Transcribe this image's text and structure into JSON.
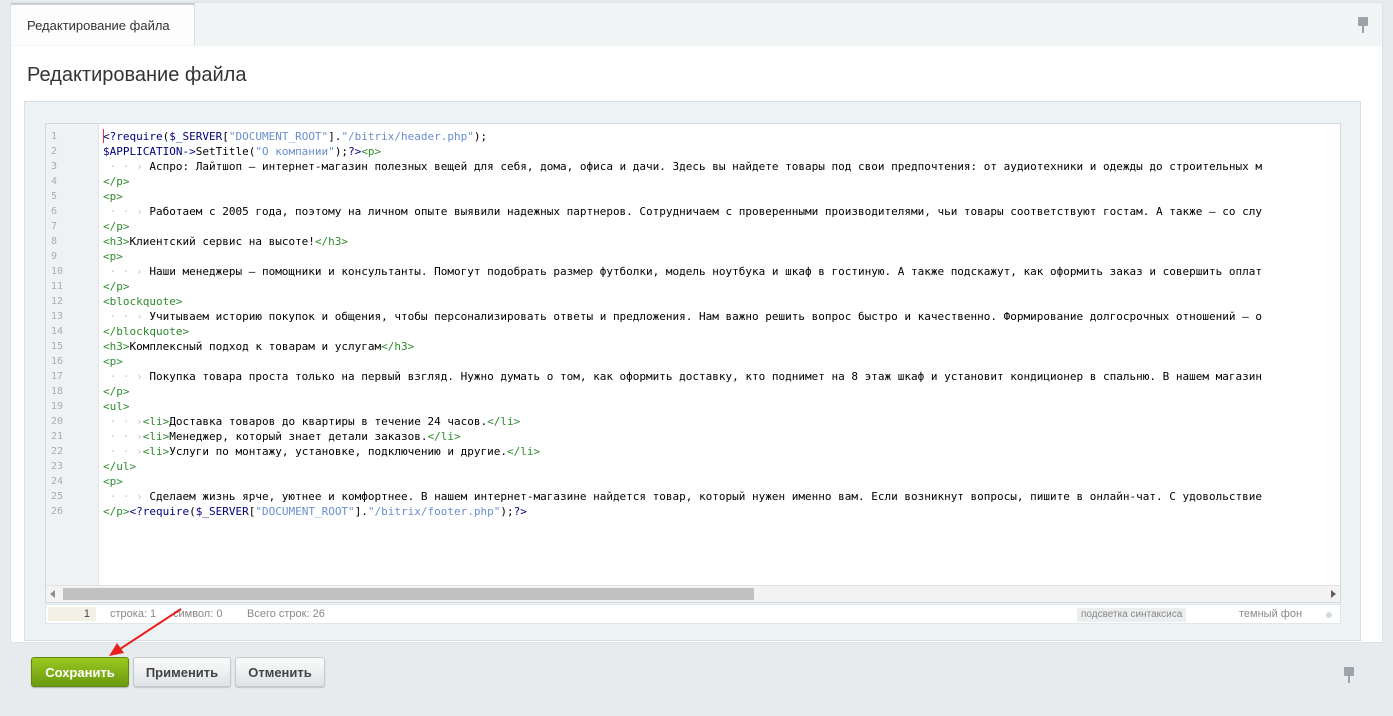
{
  "tab": {
    "label": "Редактирование файла"
  },
  "page": {
    "title": "Редактирование файла"
  },
  "editor": {
    "line_numbers": [
      "1",
      "2",
      "3",
      "4",
      "5",
      "6",
      "7",
      "8",
      "9",
      "10",
      "11",
      "12",
      "13",
      "14",
      "15",
      "16",
      "17",
      "18",
      "19",
      "20",
      "21",
      "22",
      "23",
      "24",
      "25",
      "26"
    ],
    "lines": [
      [
        {
          "t": "<?require",
          "c": "#000080"
        },
        {
          "t": "(",
          "c": "#000"
        },
        {
          "t": "$_SERVER",
          "c": "#000080"
        },
        {
          "t": "[",
          "c": "#000"
        },
        {
          "t": "\"DOCUMENT_ROOT\"",
          "c": "#6a8ed0"
        },
        {
          "t": "].",
          "c": "#000"
        },
        {
          "t": "\"/bitrix/header.php\"",
          "c": "#6a8ed0"
        },
        {
          "t": ");",
          "c": "#000"
        }
      ],
      [
        {
          "t": "$APPLICATION->",
          "c": "#000080"
        },
        {
          "t": "SetTitle(",
          "c": "#000"
        },
        {
          "t": "\"О компании\"",
          "c": "#6a8ed0"
        },
        {
          "t": ");",
          "c": "#000"
        },
        {
          "t": "?>",
          "c": "#000080"
        },
        {
          "t": "<p>",
          "c": "#2e8b2e"
        }
      ],
      [
        {
          "t": " · · › ",
          "c": "#c8c8c8"
        },
        {
          "t": "Аспро: Лайтшоп — интернет-магазин полезных вещей для себя, дома, офиса и дачи. Здесь вы найдете товары под свои предпочтения: от аудиотехники и одежды до строительных м",
          "c": "#000"
        }
      ],
      [
        {
          "t": "</p>",
          "c": "#2e8b2e"
        }
      ],
      [
        {
          "t": "<p>",
          "c": "#2e8b2e"
        }
      ],
      [
        {
          "t": " · · › ",
          "c": "#c8c8c8"
        },
        {
          "t": "Работаем с 2005 года, поэтому на личном опыте выявили надежных партнеров. Сотрудничаем с проверенными производителями, чьи товары соответствуют гостам. А также — со слу",
          "c": "#000"
        }
      ],
      [
        {
          "t": "</p>",
          "c": "#2e8b2e"
        }
      ],
      [
        {
          "t": "<h3>",
          "c": "#2e8b2e"
        },
        {
          "t": "Клиентский сервис на высоте!",
          "c": "#000"
        },
        {
          "t": "</h3>",
          "c": "#2e8b2e"
        }
      ],
      [
        {
          "t": "<p>",
          "c": "#2e8b2e"
        }
      ],
      [
        {
          "t": " · · › ",
          "c": "#c8c8c8"
        },
        {
          "t": "Наши менеджеры — помощники и консультанты. Помогут подобрать размер футболки, модель ноутбука и шкаф в гостиную. А также подскажут, как оформить заказ и совершить оплат",
          "c": "#000"
        }
      ],
      [
        {
          "t": "</p>",
          "c": "#2e8b2e"
        }
      ],
      [
        {
          "t": "<blockquote>",
          "c": "#2e8b2e"
        }
      ],
      [
        {
          "t": " · · › ",
          "c": "#c8c8c8"
        },
        {
          "t": "Учитываем историю покупок и общения, чтобы персонализировать ответы и предложения. Нам важно решить вопрос быстро и качественно. Формирование долгосрочных отношений — о",
          "c": "#000"
        }
      ],
      [
        {
          "t": "</blockquote>",
          "c": "#2e8b2e"
        }
      ],
      [
        {
          "t": "<h3>",
          "c": "#2e8b2e"
        },
        {
          "t": "Комплексный подход к товарам и услугам",
          "c": "#000"
        },
        {
          "t": "</h3>",
          "c": "#2e8b2e"
        }
      ],
      [
        {
          "t": "<p>",
          "c": "#2e8b2e"
        }
      ],
      [
        {
          "t": " · · › ",
          "c": "#c8c8c8"
        },
        {
          "t": "Покупка товара проста только на первый взгляд. Нужно думать о том, как оформить доставку, кто поднимет на 8 этаж шкаф и установит кондиционер в спальню. В нашем магазин",
          "c": "#000"
        }
      ],
      [
        {
          "t": "</p>",
          "c": "#2e8b2e"
        }
      ],
      [
        {
          "t": "<ul>",
          "c": "#2e8b2e"
        }
      ],
      [
        {
          "t": " · · ›",
          "c": "#c8c8c8"
        },
        {
          "t": "<li>",
          "c": "#2e8b2e"
        },
        {
          "t": "Доставка товаров до квартиры в течение 24 часов.",
          "c": "#000"
        },
        {
          "t": "</li>",
          "c": "#2e8b2e"
        }
      ],
      [
        {
          "t": " · · ›",
          "c": "#c8c8c8"
        },
        {
          "t": "<li>",
          "c": "#2e8b2e"
        },
        {
          "t": "Менеджер, который знает детали заказов.",
          "c": "#000"
        },
        {
          "t": "</li>",
          "c": "#2e8b2e"
        }
      ],
      [
        {
          "t": " · · ›",
          "c": "#c8c8c8"
        },
        {
          "t": "<li>",
          "c": "#2e8b2e"
        },
        {
          "t": "Услуги по монтажу, установке, подключению и другие.",
          "c": "#000"
        },
        {
          "t": "</li>",
          "c": "#2e8b2e"
        }
      ],
      [
        {
          "t": "</ul>",
          "c": "#2e8b2e"
        }
      ],
      [
        {
          "t": "<p>",
          "c": "#2e8b2e"
        }
      ],
      [
        {
          "t": " · · › ",
          "c": "#c8c8c8"
        },
        {
          "t": "Сделаем жизнь ярче, уютнее и комфортнее. В нашем интернет-магазине найдется товар, который нужен именно вам. Если возникнут вопросы, пишите в онлайн-чат. С удовольствие",
          "c": "#000"
        }
      ],
      [
        {
          "t": "</p>",
          "c": "#2e8b2e"
        },
        {
          "t": "<?require",
          "c": "#000080"
        },
        {
          "t": "(",
          "c": "#000"
        },
        {
          "t": "$_SERVER",
          "c": "#000080"
        },
        {
          "t": "[",
          "c": "#000"
        },
        {
          "t": "\"DOCUMENT_ROOT\"",
          "c": "#6a8ed0"
        },
        {
          "t": "].",
          "c": "#000"
        },
        {
          "t": "\"/bitrix/footer.php\"",
          "c": "#6a8ed0"
        },
        {
          "t": ");",
          "c": "#000"
        },
        {
          "t": "?>",
          "c": "#000080"
        }
      ]
    ]
  },
  "statusbar": {
    "current_line": "1",
    "line_label": "строка: 1",
    "symbol_label": "символ: 0",
    "total_label": "Всего строк: 26",
    "syntax_label": "подсветка синтаксиса",
    "dark_label": "темный фон"
  },
  "buttons": {
    "save": "Сохранить",
    "apply": "Применить",
    "cancel": "Отменить"
  },
  "colors": {
    "accent_green": "#7ab015",
    "annotation_arrow": "#e8201c"
  },
  "icons": {
    "pin": "pin-icon"
  }
}
